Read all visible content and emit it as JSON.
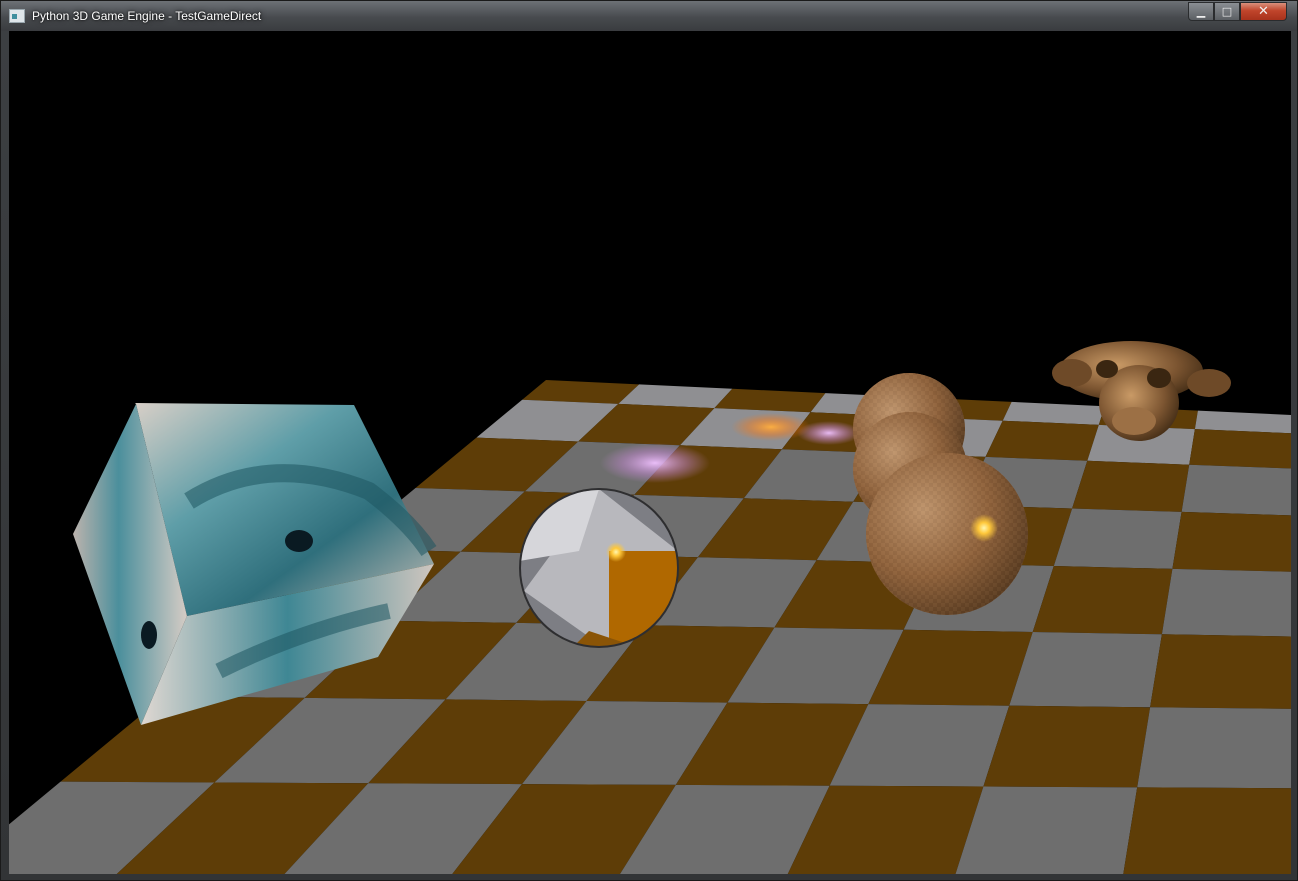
{
  "window": {
    "title": "Python 3D Game Engine - TestGameDirect",
    "minimize_glyph": "▁",
    "maximize_glyph": "□",
    "close_glyph": "✕"
  },
  "scene": {
    "floor_colors": {
      "orange": "#5e3d07",
      "gray": "#6e6e6e",
      "light_gray": "#8f8f92"
    },
    "light_color": "#ff9a2a",
    "light_glow": "#e3b0f5",
    "objects": [
      "textured-cube",
      "checkered-sphere",
      "sphere-stack",
      "monkey-head"
    ]
  }
}
